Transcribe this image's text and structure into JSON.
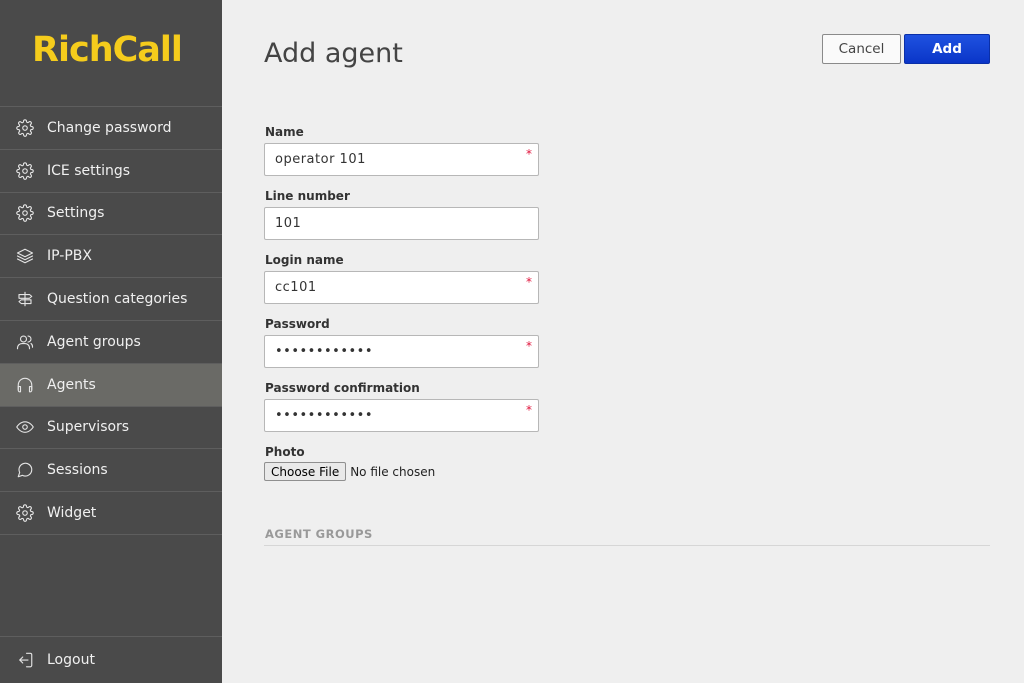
{
  "brand": {
    "logo": "RichCall",
    "color": "#f5cc1c"
  },
  "sidebar": {
    "items": [
      {
        "label": "Change password",
        "icon": "gear-icon"
      },
      {
        "label": "ICE settings",
        "icon": "gear-icon"
      },
      {
        "label": "Settings",
        "icon": "gear-icon"
      },
      {
        "label": "IP-PBX",
        "icon": "layers-icon"
      },
      {
        "label": "Question categories",
        "icon": "signpost-icon"
      },
      {
        "label": "Agent groups",
        "icon": "users-icon"
      },
      {
        "label": "Agents",
        "icon": "headphones-icon",
        "active": true
      },
      {
        "label": "Supervisors",
        "icon": "eye-icon"
      },
      {
        "label": "Sessions",
        "icon": "chat-bubble-icon"
      },
      {
        "label": "Widget",
        "icon": "gear-icon"
      }
    ],
    "logout": {
      "label": "Logout",
      "icon": "logout-icon"
    }
  },
  "page": {
    "title": "Add agent"
  },
  "actions": {
    "cancel_label": "Cancel",
    "add_label": "Add"
  },
  "form": {
    "name": {
      "label": "Name",
      "value": "operator 101",
      "required": true
    },
    "line_number": {
      "label": "Line number",
      "value": "101",
      "required": false
    },
    "login_name": {
      "label": "Login name",
      "value": "cc101",
      "required": true
    },
    "password": {
      "label": "Password",
      "value": "••••••••••••",
      "required": true
    },
    "password_confirmation": {
      "label": "Password confirmation",
      "value": "••••••••••••",
      "required": true
    },
    "photo": {
      "label": "Photo",
      "button_label": "Choose File",
      "status": "No file chosen"
    },
    "required_marker": "*"
  },
  "sections": {
    "agent_groups": "AGENT GROUPS"
  }
}
